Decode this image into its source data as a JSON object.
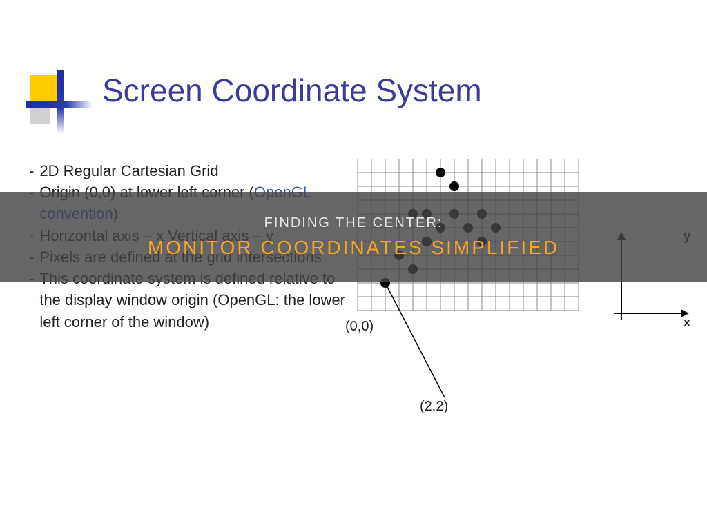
{
  "title": "Screen Coordinate System",
  "bullets": [
    {
      "pre": "2D Regular Cartesian Grid"
    },
    {
      "pre": "Origin (0,0) at lower left corner (",
      "link": "OpenGL convention",
      "post": ")"
    },
    {
      "pre": "Horizontal axis – x Vertical axis – y"
    },
    {
      "pre": "Pixels are defined at the grid intersections"
    },
    {
      "pre": "This coordinate system is defined relative to the display window origin (OpenGL: the lower left corner  of the window)"
    }
  ],
  "coords": {
    "origin": "(0,0)",
    "point": "(2,2)"
  },
  "axis": {
    "x": "x",
    "y": "y"
  },
  "overlay": {
    "line1": "FINDING THE CENTER:",
    "line2": "MONITOR COORDINATES SIMPLIFIED"
  }
}
